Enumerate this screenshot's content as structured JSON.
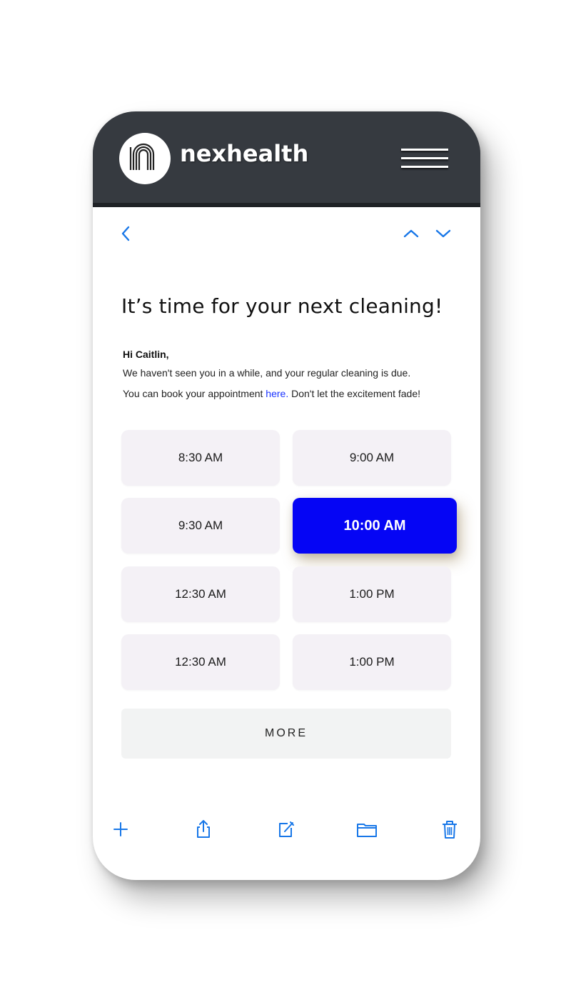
{
  "app": {
    "brand": "nexhealth"
  },
  "colors": {
    "header_bg": "#363a40",
    "accent": "#0505f5",
    "icon_blue": "#1877e8",
    "slot_bg": "#f4f1f6",
    "link": "#1a33ff"
  },
  "icons": {
    "logo": "nexhealth-n-logo",
    "menu": "hamburger-menu-icon",
    "back": "chevron-left-icon",
    "prev": "chevron-up-icon",
    "next": "chevron-down-icon",
    "toolbar": [
      "plus-icon",
      "share-icon",
      "compose-icon",
      "folder-icon",
      "trash-icon"
    ]
  },
  "email": {
    "title": "It’s time for your next cleaning!",
    "greeting": "Hi Caitlin,",
    "line1": "We haven't seen you in a while, and your regular cleaning is due.",
    "line2_before": "You can book your appointment ",
    "line2_link": "here.",
    "line2_after": " Don't let the excitement fade!"
  },
  "slots": [
    {
      "label": "8:30 AM",
      "selected": false
    },
    {
      "label": "9:00 AM",
      "selected": false
    },
    {
      "label": "9:30 AM",
      "selected": false
    },
    {
      "label": "10:00 AM",
      "selected": true
    },
    {
      "label": "12:30 AM",
      "selected": false
    },
    {
      "label": "1:00 PM",
      "selected": false
    },
    {
      "label": "12:30 AM",
      "selected": false
    },
    {
      "label": "1:00 PM",
      "selected": false
    }
  ],
  "more_label": "MORE"
}
